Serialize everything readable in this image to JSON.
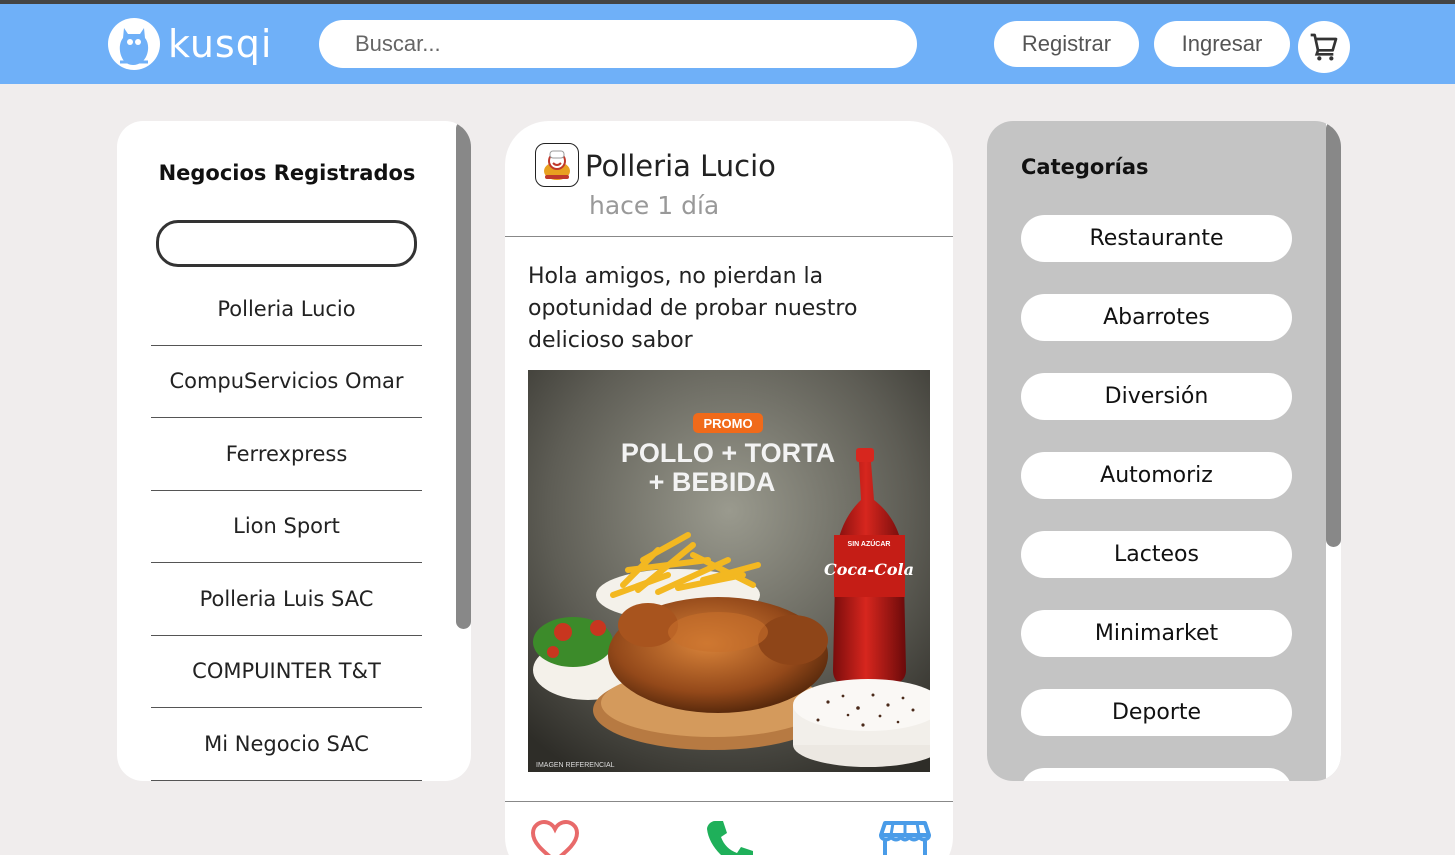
{
  "header": {
    "logo_text": "kusqi",
    "search_placeholder": "Buscar...",
    "register_label": "Registrar",
    "login_label": "Ingresar",
    "cart_icon": "cart-icon",
    "bar_color": "#6fb0f8"
  },
  "left": {
    "title": "Negocios Registrados",
    "businesses": [
      "Polleria Lucio",
      "CompuServicios Omar",
      "Ferrexpress",
      "Lion Sport",
      "Polleria Luis SAC",
      "COMPUINTER T&T",
      "Mi Negocio SAC"
    ]
  },
  "post": {
    "business_name": "Polleria Lucio",
    "time_ago": "hace 1 día",
    "text": "Hola amigos, no pierdan la opotunidad de probar nuestro delicioso sabor",
    "image": {
      "promo_label": "PROMO",
      "headline_line1": "POLLO + TORTA",
      "headline_line2": "+ BEBIDA",
      "bottle_label": "Coca-Cola",
      "bottle_sub": "SIN AZÚCAR",
      "footnote": "IMAGEN REFERENCIAL"
    },
    "actions": [
      "heart-icon",
      "phone-icon",
      "store-icon"
    ]
  },
  "right": {
    "title": "Categorías",
    "categories": [
      "Restaurante",
      "Abarrotes",
      "Diversión",
      "Automoriz",
      "Lacteos",
      "Minimarket",
      "Deporte"
    ]
  }
}
